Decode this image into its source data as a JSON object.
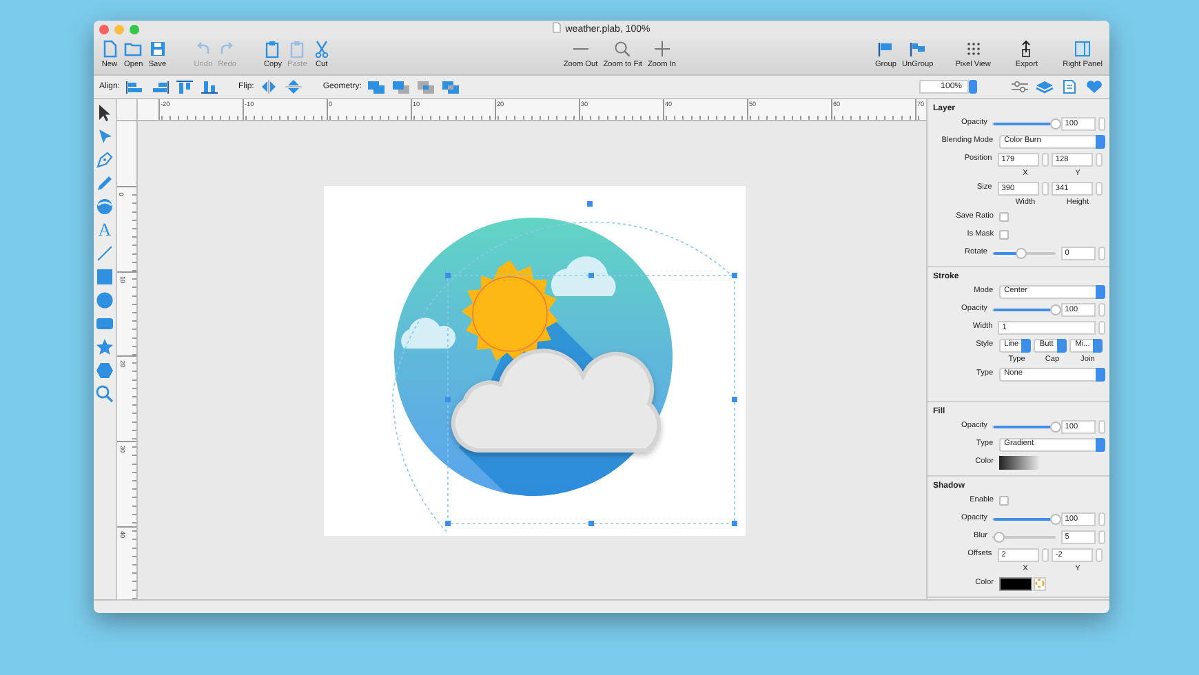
{
  "window": {
    "title": "weather.plab, 100%"
  },
  "toolbar": {
    "groups": [
      {
        "items": [
          {
            "label": "New",
            "disabled": false
          },
          {
            "label": "Open",
            "disabled": false
          },
          {
            "label": "Save",
            "disabled": false
          }
        ]
      },
      {
        "items": [
          {
            "label": "Undo",
            "disabled": true
          },
          {
            "label": "Redo",
            "disabled": true
          }
        ]
      },
      {
        "items": [
          {
            "label": "Copy",
            "disabled": false
          },
          {
            "label": "Paste",
            "disabled": true
          },
          {
            "label": "Cut",
            "disabled": false
          }
        ]
      },
      {
        "items": [
          {
            "label": "Zoom Out",
            "disabled": false
          },
          {
            "label": "Zoom to Fit",
            "disabled": false
          },
          {
            "label": "Zoom In",
            "disabled": false
          }
        ]
      },
      {
        "items": [
          {
            "label": "Group",
            "disabled": false
          },
          {
            "label": "UnGroup",
            "disabled": false
          }
        ]
      },
      {
        "items": [
          {
            "label": "Pixel View",
            "disabled": false
          },
          {
            "label": "Export",
            "disabled": false
          },
          {
            "label": "Right Panel",
            "disabled": false
          }
        ]
      }
    ]
  },
  "options_bar": {
    "align_label": "Align:",
    "flip_label": "Flip:",
    "geometry_label": "Geometry:",
    "zoom": "100%"
  },
  "tools": [
    {
      "selected": true
    },
    {
      "selected": false
    },
    {
      "selected": false
    },
    {
      "selected": false
    },
    {
      "selected": false
    },
    {
      "selected": false,
      "glyph": "A"
    },
    {
      "selected": false
    },
    {
      "selected": false
    },
    {
      "selected": false
    },
    {
      "selected": false
    },
    {
      "selected": false
    },
    {
      "selected": false
    },
    {
      "selected": false
    }
  ],
  "rulers": {
    "horizontal": [
      "-20",
      "-10",
      "0",
      "10",
      "20",
      "30",
      "40",
      "50",
      "60",
      "70"
    ],
    "vertical": [
      "0",
      "10",
      "20",
      "30",
      "40"
    ]
  },
  "panel": {
    "sections": [
      {
        "title": "Layer",
        "rows": [
          {
            "kind": "slider",
            "label": "Opacity",
            "level": 1.0,
            "value": "100"
          },
          {
            "kind": "select",
            "label": "Blending Mode",
            "value": "Color Burn"
          },
          {
            "kind": "pair",
            "label": "Position",
            "values": [
              "179",
              "128"
            ],
            "captions": [
              "X",
              "Y"
            ]
          },
          {
            "kind": "pair",
            "label": "Size",
            "values": [
              "390",
              "341"
            ],
            "captions": [
              "Width",
              "Height"
            ]
          },
          {
            "kind": "checkbox",
            "label": "Save Ratio",
            "checked": false
          },
          {
            "kind": "checkbox",
            "label": "Is Mask",
            "checked": false
          },
          {
            "kind": "slider",
            "label": "Rotate",
            "level": 0.45,
            "value": "0"
          }
        ]
      },
      {
        "title": "Stroke",
        "rows": [
          {
            "kind": "select",
            "label": "Mode",
            "value": "Center"
          },
          {
            "kind": "slider",
            "label": "Opacity",
            "level": 1.0,
            "value": "100"
          },
          {
            "kind": "number",
            "label": "Width",
            "value": "1"
          },
          {
            "kind": "triple",
            "label": "Style",
            "values": [
              "Line",
              "Butt",
              "Mi..."
            ],
            "captions": [
              "Type",
              "Cap",
              "Join"
            ]
          },
          {
            "kind": "select",
            "label": "Type",
            "value": "None"
          }
        ]
      },
      {
        "title": "Fill",
        "rows": [
          {
            "kind": "slider",
            "label": "Opacity",
            "level": 1.0,
            "value": "100"
          },
          {
            "kind": "select",
            "label": "Type",
            "value": "Gradient"
          },
          {
            "kind": "gradient",
            "label": "Color"
          }
        ]
      },
      {
        "title": "Shadow",
        "rows": [
          {
            "kind": "checkbox",
            "label": "Enable",
            "checked": false
          },
          {
            "kind": "slider",
            "label": "Opacity",
            "level": 1.0,
            "value": "100"
          },
          {
            "kind": "slider",
            "label": "Blur",
            "level": 0.1,
            "value": "5"
          },
          {
            "kind": "pair",
            "label": "Offsets",
            "values": [
              "2",
              "-2"
            ],
            "captions": [
              "X",
              "Y"
            ]
          },
          {
            "kind": "color",
            "label": "Color",
            "color": "#000000"
          }
        ]
      }
    ]
  }
}
